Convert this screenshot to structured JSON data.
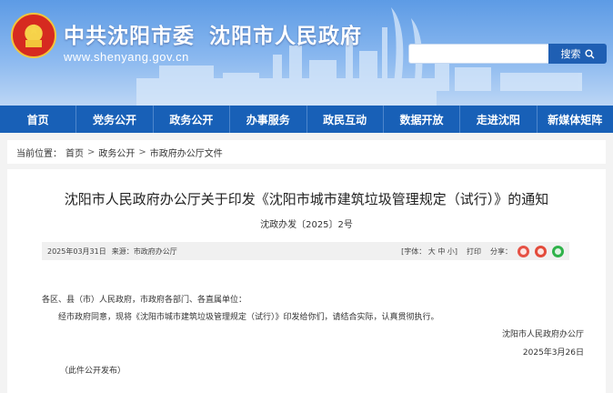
{
  "header": {
    "site_title_party": "中共沈阳市委",
    "site_title_gov": "沈阳市人民政府",
    "site_url": "www.shenyang.gov.cn",
    "search_button_label": "搜索",
    "colors": {
      "banner": "#6aa5ea",
      "nav": "#1860b7",
      "search_button": "#1f5fb3"
    }
  },
  "nav": {
    "items": [
      "首页",
      "党务公开",
      "政务公开",
      "办事服务",
      "政民互动",
      "数据开放",
      "走进沈阳",
      "新媒体矩阵"
    ]
  },
  "breadcrumb": {
    "label": "当前位置：",
    "items": [
      "首页",
      "政务公开",
      "市政府办公厅文件"
    ],
    "separator": ">"
  },
  "article": {
    "title": "沈阳市人民政府办公厅关于印发《沈阳市城市建筑垃圾管理规定（试行）》的通知",
    "doc_number": "沈政办发〔2025〕2号",
    "meta": {
      "date": "2025年03月31日",
      "source": "来源：市政府办公厅",
      "font_size_label": "[字体：",
      "font_large": "大",
      "font_medium": "中",
      "font_small": "小]",
      "print_label": "打印",
      "share_label": "分享："
    },
    "salutation": "各区、县（市）人民政府，市政府各部门、各直属单位：",
    "paragraph": "经市政府同意，现将《沈阳市城市建筑垃圾管理规定（试行）》印发给你们，请结合实际，认真贯彻执行。",
    "signature": "沈阳市人民政府办公厅",
    "sign_date": "2025年3月26日",
    "note": "（此件公开发布）"
  }
}
